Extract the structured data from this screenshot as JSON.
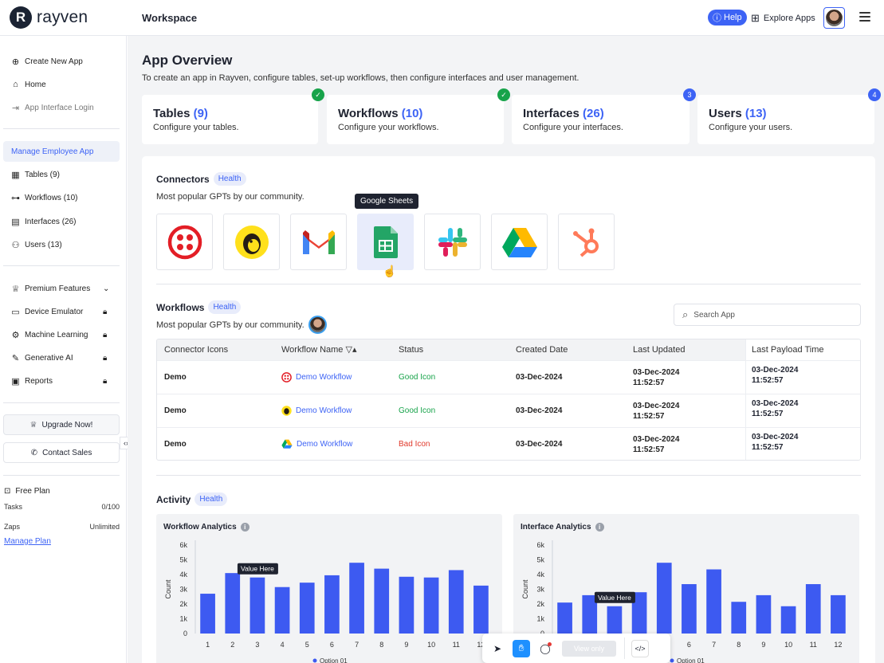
{
  "brand": {
    "name": "rayven"
  },
  "topbar": {
    "workspace": "Workspace",
    "help": "Help",
    "explore": "Explore Apps"
  },
  "sidebar": {
    "top_items": [
      {
        "label": "Create New App",
        "icon": "plus-circle-icon"
      },
      {
        "label": "Home",
        "icon": "home-icon"
      },
      {
        "label": "App Interface Login",
        "icon": "login-icon"
      }
    ],
    "app_title": "Manage Employee App",
    "app_items": [
      {
        "label": "Tables (9)",
        "icon": "table-icon"
      },
      {
        "label": "Workflows (10)",
        "icon": "workflow-icon"
      },
      {
        "label": "Interfaces (26)",
        "icon": "interface-icon"
      },
      {
        "label": "Users (13)",
        "icon": "users-icon"
      }
    ],
    "premium": "Premium Features",
    "premium_items": [
      {
        "label": "Device Emulator",
        "icon": "device-icon"
      },
      {
        "label": "Machine Learning",
        "icon": "ml-icon"
      },
      {
        "label": "Generative AI",
        "icon": "magic-icon"
      },
      {
        "label": "Reports",
        "icon": "report-icon"
      }
    ],
    "upgrade": "Upgrade Now!",
    "contact": "Contact Sales",
    "plan": {
      "title": "Free Plan",
      "tasks_label": "Tasks",
      "tasks_value": "0/100",
      "zaps_label": "Zaps",
      "zaps_value": "Unlimited",
      "manage": "Manage Plan"
    }
  },
  "main": {
    "title": "App Overview",
    "subtitle": "To create an app in Rayven, configure tables, set-up workflows, then configure interfaces and user management.",
    "cards": [
      {
        "name": "Tables",
        "count": "(9)",
        "desc": "Configure your tables.",
        "badge": "✓",
        "badge_color": "#17a34a"
      },
      {
        "name": "Workflows",
        "count": "(10)",
        "desc": "Configure your workflows.",
        "badge": "✓",
        "badge_color": "#17a34a"
      },
      {
        "name": "Interfaces",
        "count": "(26)",
        "desc": "Configure your interfaces.",
        "badge": "3",
        "badge_color": "#3d63f5"
      },
      {
        "name": "Users",
        "count": "(13)",
        "desc": "Configure your users.",
        "badge": "4",
        "badge_color": "#3d63f5"
      }
    ],
    "connectors": {
      "title": "Connectors",
      "pill": "Health",
      "sub": "Most popular GPTs by our community.",
      "tooltip": "Google Sheets",
      "items": [
        "twilio-icon",
        "mailchimp-icon",
        "gmail-icon",
        "google-sheets-icon",
        "slack-icon",
        "google-drive-icon",
        "hubspot-icon"
      ]
    },
    "workflows": {
      "title": "Workflows",
      "pill": "Health",
      "sub": "Most popular GPTs by our community.",
      "search_placeholder": "Search App",
      "headers": [
        "Connector Icons",
        "Workflow Name",
        "Status",
        "Created Date",
        "Last Updated",
        "Last Payload Time"
      ],
      "rows": [
        {
          "connector": "Demo",
          "icon": "twilio-icon",
          "name": "Demo Workflow",
          "status": "Good Icon",
          "created": "03-Dec-2024",
          "updated_date": "03-Dec-2024",
          "updated_time": "11:52:57",
          "payload_date": "03-Dec-2024",
          "payload_time": "11:52:57"
        },
        {
          "connector": "Demo",
          "icon": "mailchimp-icon",
          "name": "Demo Workflow",
          "status": "Good Icon",
          "created": "03-Dec-2024",
          "updated_date": "03-Dec-2024",
          "updated_time": "11:52:57",
          "payload_date": "03-Dec-2024",
          "payload_time": "11:52:57"
        },
        {
          "connector": "Demo",
          "icon": "google-drive-icon",
          "name": "Demo Workflow",
          "status": "Bad Icon",
          "created": "03-Dec-2024",
          "updated_date": "03-Dec-2024",
          "updated_time": "11:52:57",
          "payload_date": "03-Dec-2024",
          "payload_time": "11:52:57"
        }
      ]
    },
    "activity": {
      "title": "Activity",
      "pill": "Health"
    }
  },
  "chart_data": [
    {
      "type": "bar",
      "title": "Workflow Analytics",
      "ylabel": "Count",
      "xlabel": "",
      "categories": [
        "1",
        "2",
        "3",
        "4",
        "5",
        "6",
        "7",
        "8",
        "9",
        "10",
        "11",
        "12"
      ],
      "values": [
        2700,
        4100,
        3800,
        3150,
        3450,
        3950,
        4800,
        4400,
        3850,
        3800,
        4300,
        3250
      ],
      "ylim": [
        0,
        6000
      ],
      "yticks": [
        "0",
        "1k",
        "2k",
        "3k",
        "4k",
        "5k",
        "6k"
      ],
      "tooltip": "Value Here",
      "tooltip_index": 2,
      "legend": "Option 01",
      "color": "#3d5af1"
    },
    {
      "type": "bar",
      "title": "Interface Analytics",
      "ylabel": "Count",
      "xlabel": "",
      "categories": [
        "1",
        "2",
        "3",
        "4",
        "5",
        "6",
        "7",
        "8",
        "9",
        "10",
        "11",
        "12"
      ],
      "values": [
        2100,
        2600,
        1850,
        2800,
        4800,
        3350,
        4350,
        2150,
        2600,
        1850,
        3350,
        2600
      ],
      "ylim": [
        0,
        6000
      ],
      "yticks": [
        "0",
        "1k",
        "2k",
        "3k",
        "4k",
        "5k",
        "6k"
      ],
      "tooltip": "Value Here",
      "tooltip_index": 2,
      "legend": "Option 01",
      "color": "#3d5af1"
    }
  ],
  "toolbar": {
    "view_only": "View only"
  }
}
